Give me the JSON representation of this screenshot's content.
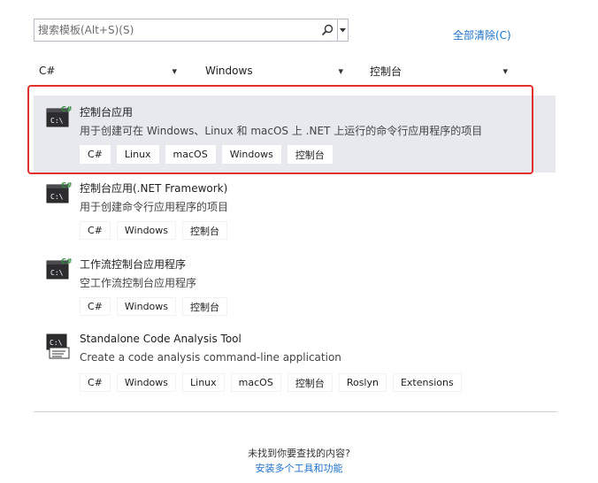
{
  "search": {
    "placeholder": "搜索模板(Alt+S)(S)",
    "clear_all": "全部清除(C)"
  },
  "filters": {
    "language": "C#",
    "platform": "Windows",
    "project_type": "控制台"
  },
  "templates": [
    {
      "title": "控制台应用",
      "description": "用于创建可在 Windows、Linux 和 macOS 上 .NET 上运行的命令行应用程序的项目",
      "tags": [
        "C#",
        "Linux",
        "macOS",
        "Windows",
        "控制台"
      ],
      "selected": true,
      "icon": "console-csharp-icon"
    },
    {
      "title": "控制台应用(.NET Framework)",
      "description": "用于创建命令行应用程序的项目",
      "tags": [
        "C#",
        "Windows",
        "控制台"
      ],
      "icon": "console-csharp-icon"
    },
    {
      "title": "工作流控制台应用程序",
      "description": "空工作流控制台应用程序",
      "tags": [
        "C#",
        "Windows",
        "控制台"
      ],
      "icon": "console-csharp-icon"
    },
    {
      "title": "Standalone Code Analysis Tool",
      "description": "Create a code analysis command-line application",
      "tags": [
        "C#",
        "Windows",
        "Linux",
        "macOS",
        "控制台",
        "Roslyn",
        "Extensions"
      ],
      "icon": "code-analysis-icon"
    }
  ],
  "footer": {
    "not_found": "未找到你要查找的内容?",
    "install_link": "安装多个工具和功能"
  },
  "colors": {
    "accent": "#1e72c8",
    "selection_bg": "#e7e9ef",
    "highlight_border": "#e1312b"
  }
}
